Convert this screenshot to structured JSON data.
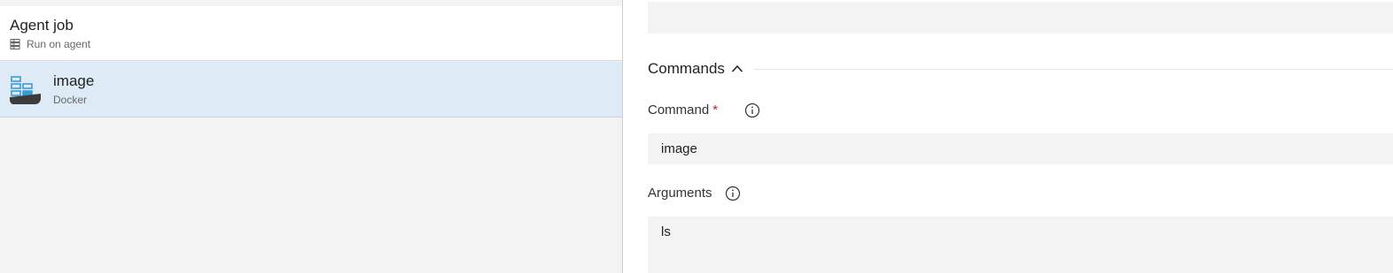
{
  "left": {
    "agent_job": {
      "title": "Agent job",
      "subtitle": "Run on agent",
      "icon": "server-icon"
    },
    "task": {
      "title": "image",
      "subtitle": "Docker",
      "icon": "docker-icon",
      "selected": true
    }
  },
  "right": {
    "top_input": {
      "value": ""
    },
    "section": {
      "title": "Commands",
      "expanded": true
    },
    "command": {
      "label": "Command",
      "required_mark": "*",
      "value": "image"
    },
    "arguments": {
      "label": "Arguments",
      "value": "ls"
    }
  },
  "colors": {
    "selected_bg": "#deebf7",
    "panel_bg": "#f3f3f3",
    "input_bg": "#f3f3f3",
    "required": "#c4262e",
    "docker_blue": "#3a9bd9",
    "docker_dark": "#3c3c3c"
  }
}
